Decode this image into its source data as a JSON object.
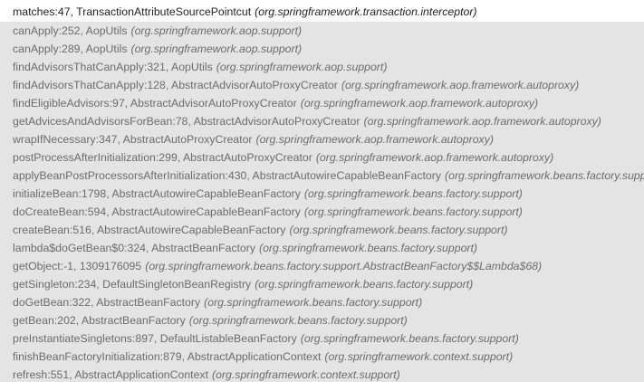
{
  "frames": [
    {
      "method": "matches:47, TransactionAttributeSourcePointcut",
      "package": "(org.springframework.transaction.interceptor)",
      "selected": true
    },
    {
      "method": "canApply:252, AopUtils",
      "package": "(org.springframework.aop.support)"
    },
    {
      "method": "canApply:289, AopUtils",
      "package": "(org.springframework.aop.support)"
    },
    {
      "method": "findAdvisorsThatCanApply:321, AopUtils",
      "package": "(org.springframework.aop.support)"
    },
    {
      "method": "findAdvisorsThatCanApply:128, AbstractAdvisorAutoProxyCreator",
      "package": "(org.springframework.aop.framework.autoproxy)"
    },
    {
      "method": "findEligibleAdvisors:97, AbstractAdvisorAutoProxyCreator",
      "package": "(org.springframework.aop.framework.autoproxy)"
    },
    {
      "method": "getAdvicesAndAdvisorsForBean:78, AbstractAdvisorAutoProxyCreator",
      "package": "(org.springframework.aop.framework.autoproxy)"
    },
    {
      "method": "wrapIfNecessary:347, AbstractAutoProxyCreator",
      "package": "(org.springframework.aop.framework.autoproxy)"
    },
    {
      "method": "postProcessAfterInitialization:299, AbstractAutoProxyCreator",
      "package": "(org.springframework.aop.framework.autoproxy)"
    },
    {
      "method": "applyBeanPostProcessorsAfterInitialization:430, AbstractAutowireCapableBeanFactory",
      "package": "(org.springframework.beans.factory.support)"
    },
    {
      "method": "initializeBean:1798, AbstractAutowireCapableBeanFactory",
      "package": "(org.springframework.beans.factory.support)"
    },
    {
      "method": "doCreateBean:594, AbstractAutowireCapableBeanFactory",
      "package": "(org.springframework.beans.factory.support)"
    },
    {
      "method": "createBean:516, AbstractAutowireCapableBeanFactory",
      "package": "(org.springframework.beans.factory.support)"
    },
    {
      "method": "lambda$doGetBean$0:324, AbstractBeanFactory",
      "package": "(org.springframework.beans.factory.support)"
    },
    {
      "method": "getObject:-1, 1309176095",
      "package": "(org.springframework.beans.factory.support.AbstractBeanFactory$$Lambda$68)"
    },
    {
      "method": "getSingleton:234, DefaultSingletonBeanRegistry",
      "package": "(org.springframework.beans.factory.support)"
    },
    {
      "method": "doGetBean:322, AbstractBeanFactory",
      "package": "(org.springframework.beans.factory.support)"
    },
    {
      "method": "getBean:202, AbstractBeanFactory",
      "package": "(org.springframework.beans.factory.support)"
    },
    {
      "method": "preInstantiateSingletons:897, DefaultListableBeanFactory",
      "package": "(org.springframework.beans.factory.support)"
    },
    {
      "method": "finishBeanFactoryInitialization:879, AbstractApplicationContext",
      "package": "(org.springframework.context.support)"
    },
    {
      "method": "refresh:551, AbstractApplicationContext",
      "package": "(org.springframework.context.support)"
    }
  ]
}
